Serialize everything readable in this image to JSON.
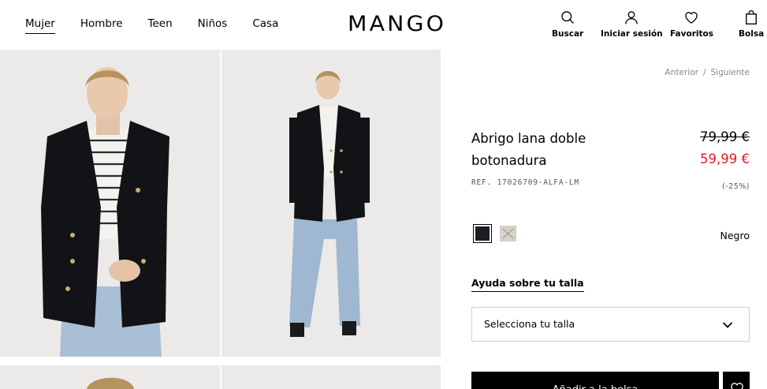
{
  "header": {
    "nav": [
      "Mujer",
      "Hombre",
      "Teen",
      "Niños",
      "Casa"
    ],
    "logo": "MANGO",
    "icons": {
      "buscar": {
        "label": "Buscar",
        "icon": "search-icon"
      },
      "sesion": {
        "label": "Iniciar sesión",
        "icon": "user-icon"
      },
      "favoritos": {
        "label": "Favoritos",
        "icon": "heart-icon"
      },
      "bolsa": {
        "label": "Bolsa",
        "icon": "bag-icon"
      }
    }
  },
  "breadcrumb": {
    "prev": "Anterior",
    "sep": "/",
    "next": "Siguiente"
  },
  "product": {
    "title_line1": "Abrigo lana doble",
    "title_line2": "botonadura",
    "old_price": "79,99 €",
    "new_price": "59,99 €",
    "ref": "REF. 17026709-ALFA-LM",
    "discount": "(-25%)",
    "selected_color": "Negro",
    "size_help": "Ayuda sobre tu talla",
    "size_placeholder": "Selecciona tu talla",
    "add_to_bag": "Añadir a la bolsa"
  },
  "colors": {
    "accent_red": "#e01b22",
    "swatch_black": "#1c1d22",
    "swatch_beige": "#d6d0c7"
  }
}
